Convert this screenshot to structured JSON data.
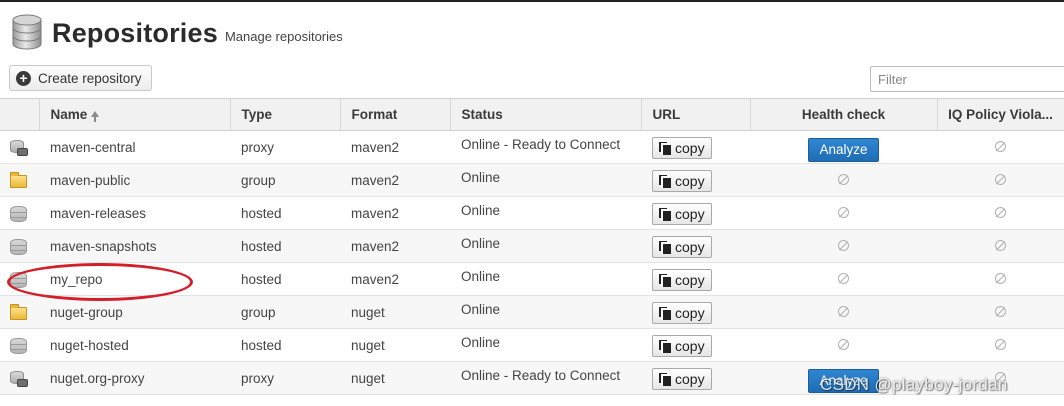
{
  "page": {
    "title": "Repositories",
    "subtitle": "Manage repositories",
    "header_icon": "database-icon"
  },
  "toolbar": {
    "create_label": "Create repository",
    "create_icon": "plus-circle-icon",
    "filter_placeholder": "Filter"
  },
  "table": {
    "columns": {
      "name": "Name",
      "type": "Type",
      "format": "Format",
      "status": "Status",
      "url": "URL",
      "health": "Health check",
      "iq": "IQ Policy Viola..."
    },
    "sort": {
      "column": "name",
      "direction": "ascending",
      "icon": "sort-up-arrow-icon"
    },
    "copy_label": "copy",
    "analyze_label": "Analyze",
    "rows": [
      {
        "icon": "proxy",
        "name": "maven-central",
        "type": "proxy",
        "format": "maven2",
        "status": "Online - Ready to Connect",
        "health": "analyze",
        "iq": "na"
      },
      {
        "icon": "group",
        "name": "maven-public",
        "type": "group",
        "format": "maven2",
        "status": "Online",
        "health": "na",
        "iq": "na"
      },
      {
        "icon": "hosted",
        "name": "maven-releases",
        "type": "hosted",
        "format": "maven2",
        "status": "Online",
        "health": "na",
        "iq": "na"
      },
      {
        "icon": "hosted",
        "name": "maven-snapshots",
        "type": "hosted",
        "format": "maven2",
        "status": "Online",
        "health": "na",
        "iq": "na"
      },
      {
        "icon": "hosted",
        "name": "my_repo",
        "type": "hosted",
        "format": "maven2",
        "status": "Online",
        "health": "na",
        "iq": "na"
      },
      {
        "icon": "group",
        "name": "nuget-group",
        "type": "group",
        "format": "nuget",
        "status": "Online",
        "health": "na",
        "iq": "na"
      },
      {
        "icon": "hosted",
        "name": "nuget-hosted",
        "type": "hosted",
        "format": "nuget",
        "status": "Online",
        "health": "na",
        "iq": "na"
      },
      {
        "icon": "proxy",
        "name": "nuget.org-proxy",
        "type": "proxy",
        "format": "nuget",
        "status": "Online - Ready to Connect",
        "health": "analyze",
        "iq": "na"
      }
    ]
  },
  "annotation": {
    "highlight_row": "my_repo",
    "color": "#d21f2a"
  },
  "watermark": "CSDN @playboy-jordan"
}
